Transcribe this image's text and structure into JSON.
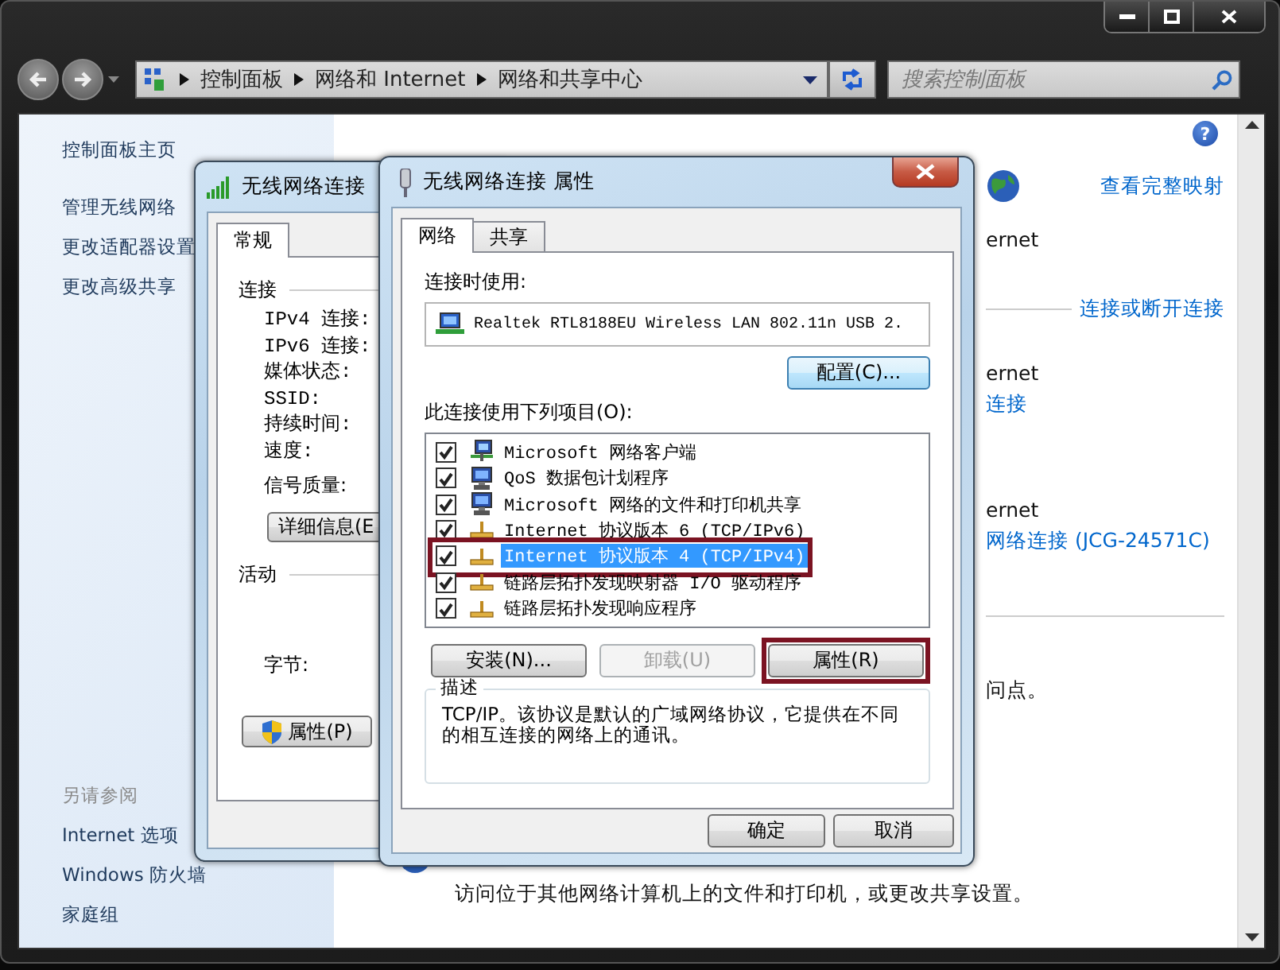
{
  "explorer": {
    "breadcrumb": [
      "控制面板",
      "网络和 Internet",
      "网络和共享中心"
    ],
    "search": {
      "placeholder": "搜索控制面板"
    },
    "help": "?",
    "sidebar": {
      "items": [
        "控制面板主页",
        "管理无线网络",
        "更改适配器设置",
        "更改高级共享"
      ],
      "see_also_title": "另请参阅",
      "see_also": [
        "Internet 选项",
        "Windows 防火墙",
        "家庭组"
      ]
    },
    "main": {
      "view_full_map": "查看完整映射",
      "fragments": [
        {
          "kind": "text",
          "text": "ernet"
        },
        {
          "kind": "section_link",
          "text": "连接或断开连接"
        },
        {
          "kind": "text",
          "text": "ernet"
        },
        {
          "kind": "link",
          "text": "连接"
        },
        {
          "kind": "text",
          "text": "ernet"
        },
        {
          "kind": "link",
          "text": "网络连接 (JCG-24571C)"
        },
        {
          "kind": "divider"
        },
        {
          "kind": "text",
          "text": "问点。"
        }
      ],
      "footer_text": "访问位于其他网络计算机上的文件和打印机，或更改共享设置。"
    }
  },
  "status_dialog": {
    "title": "无线网络连接",
    "tabs": [
      {
        "label": "常规",
        "selected": true
      }
    ],
    "connection_label": "连接",
    "fields": [
      "IPv4 连接:",
      "IPv6 连接:",
      "媒体状态:",
      "SSID:",
      "持续时间:",
      "速度:"
    ],
    "signal_label": "信号质量:",
    "details_button": "详细信息(E",
    "activity_label": "活动",
    "bytes_label": "字节:",
    "properties_button": "属性(P)"
  },
  "properties_dialog": {
    "title": "无线网络连接 属性",
    "tabs": [
      {
        "label": "网络",
        "selected": true
      },
      {
        "label": "共享",
        "selected": false
      }
    ],
    "connect_using_label": "连接时使用:",
    "adapter": "Realtek RTL8188EU Wireless LAN 802.11n USB 2.",
    "configure_button": "配置(C)...",
    "items_label": "此连接使用下列项目(O):",
    "items": [
      {
        "label": "Microsoft 网络客户端",
        "kind": "client",
        "checked": true,
        "selected": false,
        "highlighted": false
      },
      {
        "label": "QoS 数据包计划程序",
        "kind": "service",
        "checked": true,
        "selected": false,
        "highlighted": false
      },
      {
        "label": "Microsoft 网络的文件和打印机共享",
        "kind": "service",
        "checked": true,
        "selected": false,
        "highlighted": false
      },
      {
        "label": "Internet 协议版本 6 (TCP/IPv6)",
        "kind": "protocol",
        "checked": true,
        "selected": false,
        "highlighted": false
      },
      {
        "label": "Internet 协议版本 4 (TCP/IPv4)",
        "kind": "protocol",
        "checked": true,
        "selected": true,
        "highlighted": true
      },
      {
        "label": "链路层拓扑发现映射器 I/O 驱动程序",
        "kind": "protocol",
        "checked": true,
        "selected": false,
        "highlighted": false
      },
      {
        "label": "链路层拓扑发现响应程序",
        "kind": "protocol",
        "checked": true,
        "selected": false,
        "highlighted": false
      }
    ],
    "buttons": [
      {
        "label": "安装(N)...",
        "disabled": false,
        "highlighted": false
      },
      {
        "label": "卸载(U)",
        "disabled": true,
        "highlighted": false
      },
      {
        "label": "属性(R)",
        "disabled": false,
        "highlighted": true
      }
    ],
    "description_label": "描述",
    "description": "TCP/IP。该协议是默认的广域网络协议，它提供在不同的相互连接的网络上的通讯。",
    "ok_button": "确定",
    "cancel_button": "取消"
  }
}
